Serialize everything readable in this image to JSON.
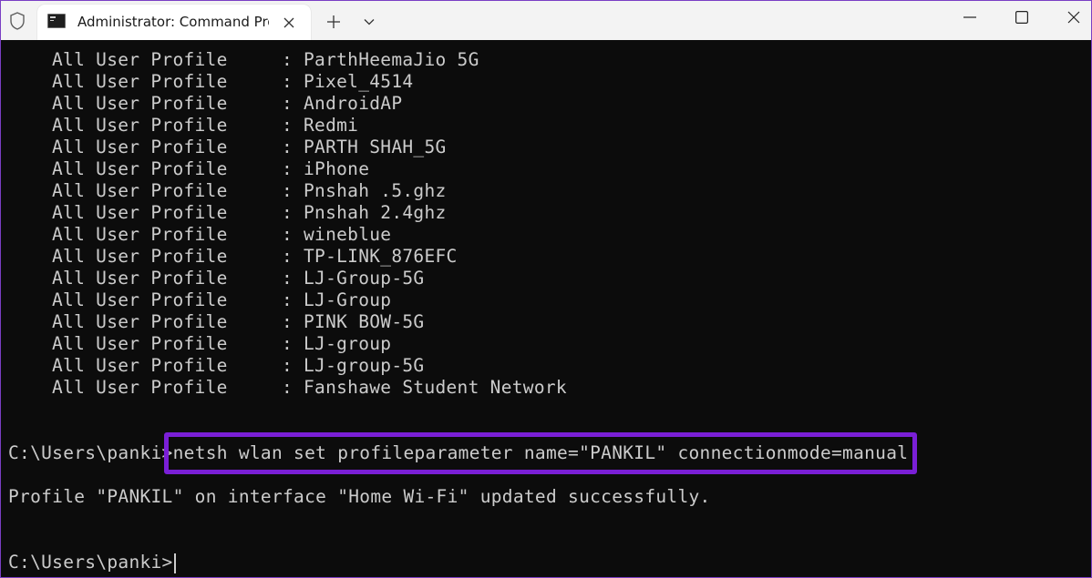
{
  "window": {
    "tab_title": "Administrator: Command Pro",
    "colors": {
      "terminal_bg": "#0c0c0c",
      "terminal_text": "#cccccc",
      "highlight_border": "#7a1fd6",
      "tabbar_bg": "#f3f3f3"
    },
    "icons": {
      "shield": "shield-icon",
      "tab": "terminal-icon",
      "tab_close": "close-icon",
      "new_tab": "plus-icon",
      "dropdown": "chevron-down-icon",
      "minimize": "minimize-icon",
      "maximize": "maximize-icon",
      "close": "close-icon"
    }
  },
  "terminal": {
    "profile_label": "All User Profile",
    "separator": ":",
    "profiles": [
      "ParthHeemaJio 5G",
      "Pixel_4514",
      "AndroidAP",
      "Redmi",
      "PARTH SHAH_5G",
      "iPhone",
      "Pnshah .5.ghz",
      "Pnshah 2.4ghz",
      "wineblue",
      "TP-LINK_876EFC",
      "LJ-Group-5G",
      "LJ-Group",
      "PINK BOW-5G",
      "LJ-group",
      "LJ-group-5G",
      "Fanshawe Student Network"
    ],
    "prompt": "C:\\Users\\panki>",
    "command": "netsh wlan set profileparameter name=\"PANKIL\" connectionmode=manual",
    "result": "Profile \"PANKIL\" on interface \"Home Wi-Fi\" updated successfully.",
    "final_prompt": "C:\\Users\\panki>"
  }
}
